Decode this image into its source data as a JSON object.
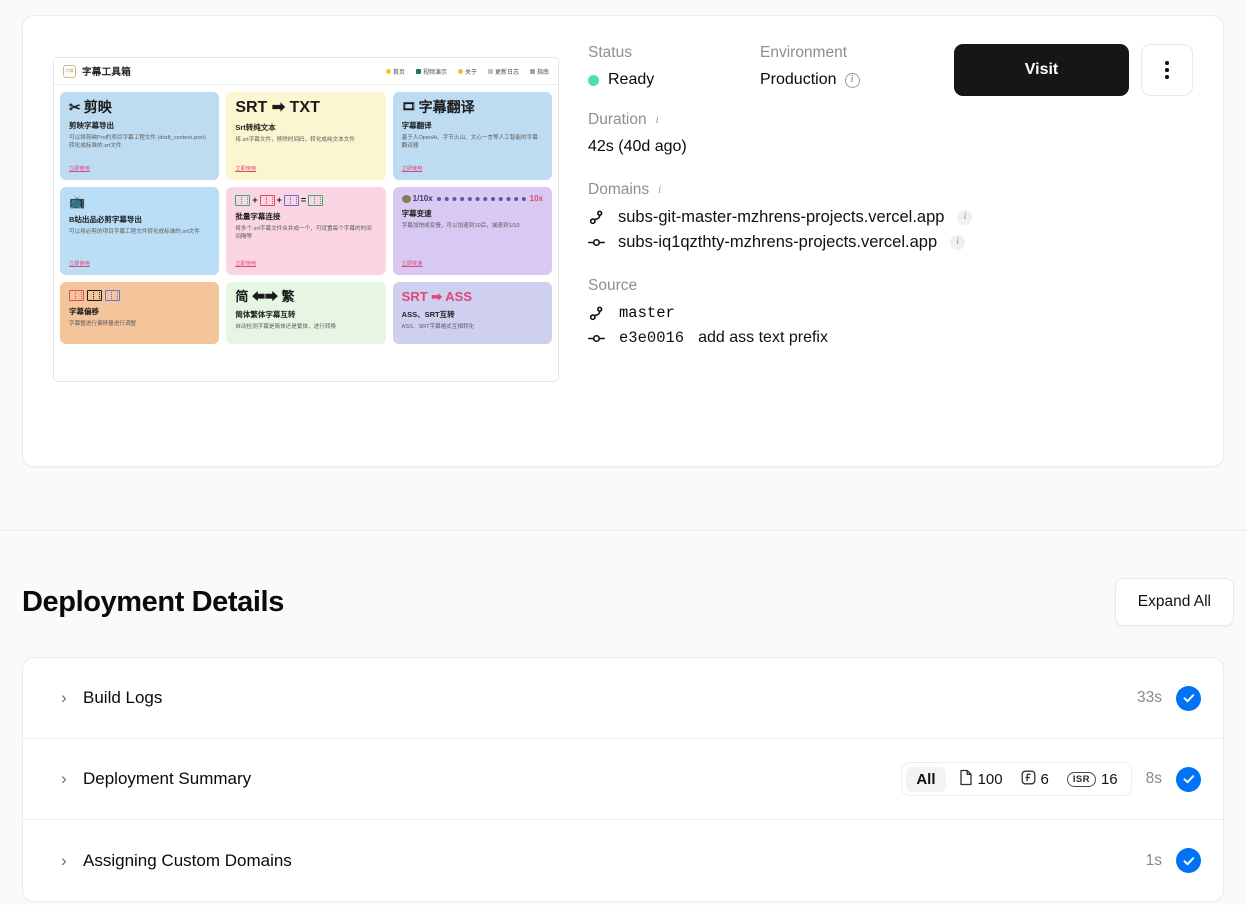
{
  "overview": {
    "status": {
      "label": "Status",
      "value": "Ready",
      "dot_color": "#4ee0ab"
    },
    "environment": {
      "label": "Environment",
      "value": "Production"
    },
    "duration": {
      "label": "Duration",
      "value": "42s (40d ago)"
    },
    "domains": {
      "label": "Domains",
      "items": [
        {
          "name": "subs-git-master-mzhrens-projects.vercel.app",
          "icon": "git-branch-icon"
        },
        {
          "name": "subs-iq1qzthty-mzhrens-projects.vercel.app",
          "icon": "git-commit-icon"
        }
      ]
    },
    "source": {
      "label": "Source",
      "branch": "master",
      "commit_hash": "e3e0016",
      "commit_message": "add ass text prefix"
    },
    "actions": {
      "visit_label": "Visit",
      "menu_icon": "more-vertical-icon"
    }
  },
  "preview": {
    "brand": "字幕工具箱",
    "nav": [
      {
        "label": "首页",
        "dot": "#f5c518"
      },
      {
        "label": "视频演示",
        "dot": "#1f7a4d"
      },
      {
        "label": "关于",
        "dot": "#f5b942"
      },
      {
        "label": "更新日志",
        "dot": "#b8c4cc"
      },
      {
        "label": "指南",
        "dot": "#9aa3ab"
      }
    ],
    "cards": [
      {
        "hero": "剪映",
        "hero_mark": "✂",
        "title": "剪映字幕导出",
        "desc": "可以将剪映Pro的项目字幕工程文件 (draft_content.json) 转化成标准的.srt文件",
        "link": "立即使用",
        "bg": "#bddcf2"
      },
      {
        "hero": "SRT ➡ TXT",
        "hero_mark": "",
        "title": "Srt转纯文本",
        "desc": "将.srt字幕文件，移除时间码，转化成纯文本文件",
        "link": "立即使用",
        "bg": "#fbf6cf"
      },
      {
        "hero": "字幕翻译",
        "hero_mark": "🎞",
        "title": "字幕翻译",
        "desc": "基于人OpenAi、字节火山、文心一言等人工智能的字幕翻译器",
        "link": "立即使用",
        "bg": "#bddcf2"
      },
      {
        "hero": "",
        "hero_mark": "📺",
        "title": "B站出品必剪字幕导出",
        "desc": "可以将必剪的项目字幕工程文件转化成标准的.srt文件",
        "link": "立即使用",
        "bg": "#b9def5"
      },
      {
        "hero": "",
        "hero_mark": "🎬",
        "title": "批量字幕连接",
        "desc": "将多个.srt字幕文件合并成一个，可设置每个字幕的时间间隔等",
        "link": "立即使用",
        "bg": "#fbd5e4"
      },
      {
        "hero": "字幕变速",
        "hero_mark": "⏱",
        "title": "字幕变速",
        "desc": "字幕加快或变慢，可以加速到10后，减速到1/10",
        "link": "立即变速",
        "bg": "#d8c9f2"
      },
      {
        "hero": "",
        "hero_mark": "🎞",
        "title": "字幕偏移",
        "desc": "字幕整进行偏移量进行调整",
        "link": "",
        "bg": "#f4c49a"
      },
      {
        "hero": "简 ⬅➡ 繁",
        "hero_mark": "",
        "title": "简体繁体字幕互转",
        "desc": "自动检测字幕是简体还是繁体，进行转换",
        "link": "",
        "bg": "#e7f5e3"
      },
      {
        "hero": "SRT ➡ ASS",
        "hero_mark": "",
        "title": "ASS、SRT互转",
        "desc": "ASS、SRT字幕格式互相转化",
        "link": "",
        "bg": "#cfcff0"
      }
    ]
  },
  "deployment_details": {
    "title": "Deployment Details",
    "expand_all": "Expand All",
    "rows": [
      {
        "label": "Build Logs",
        "time": "33s",
        "status": "success"
      },
      {
        "label": "Deployment Summary",
        "time": "8s",
        "status": "success",
        "summary": {
          "all": "All",
          "static": "100",
          "functions": "6",
          "isr_tag": "ISR",
          "isr": "16"
        }
      },
      {
        "label": "Assigning Custom Domains",
        "time": "1s",
        "status": "success"
      }
    ]
  },
  "colors": {
    "accent_blue": "#0072f5",
    "button_dark": "#161616",
    "status_green": "#4ee0ab"
  }
}
